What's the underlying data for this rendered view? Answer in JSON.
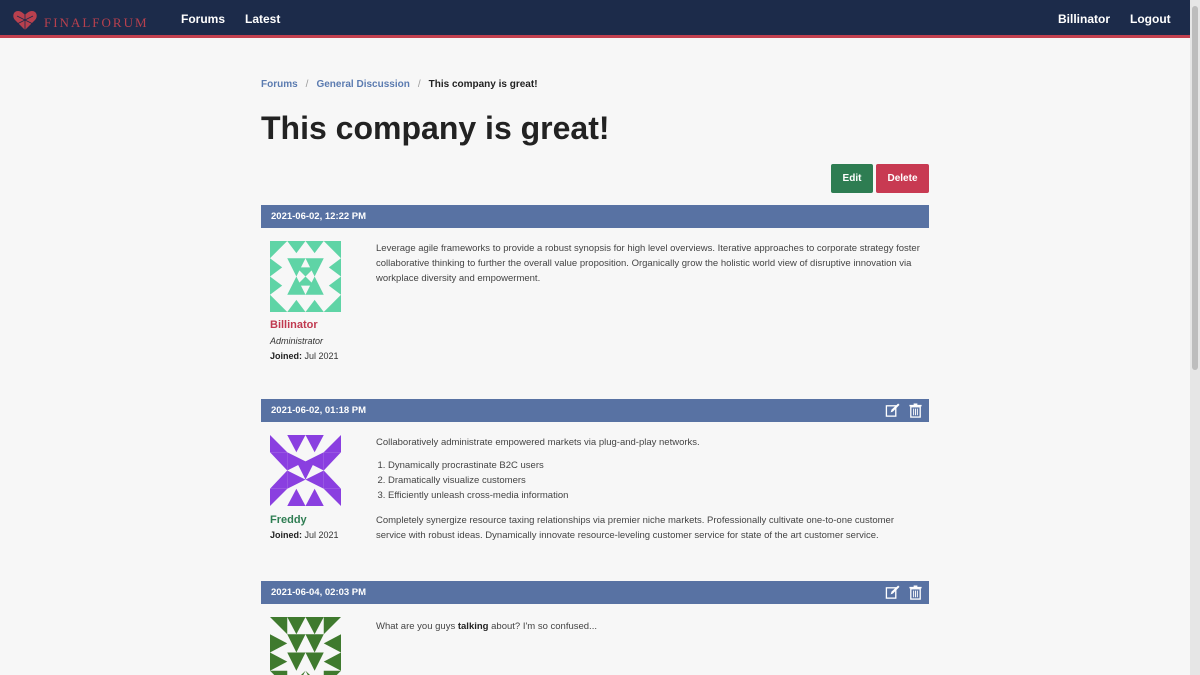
{
  "nav": {
    "brand": "FINALFORUM",
    "links": [
      "Forums",
      "Latest"
    ],
    "user": "Billinator",
    "logout": "Logout",
    "colors": {
      "bar": "#1c2b4a",
      "accent": "#c2404f"
    }
  },
  "breadcrumb": {
    "items": [
      "Forums",
      "General Discussion"
    ],
    "current": "This company is great!"
  },
  "title": "This company is great!",
  "actions": {
    "edit": "Edit",
    "delete": "Delete"
  },
  "posts": [
    {
      "timestamp": "2021-06-02, 12:22 PM",
      "show_actions": false,
      "author": {
        "name": "Billinator",
        "name_color": "#c0394f",
        "role": "Administrator",
        "joined_label": "Joined:",
        "joined": "Jul 2021",
        "avatar_color": "#5fd4a6"
      },
      "body": {
        "paragraphs": [
          "Leverage agile frameworks to provide a robust synopsis for high level overviews. Iterative approaches to corporate strategy foster collaborative thinking to further the overall value proposition. Organically grow the holistic world view of disruptive innovation via workplace diversity and empowerment."
        ]
      }
    },
    {
      "timestamp": "2021-06-02, 01:18 PM",
      "show_actions": true,
      "author": {
        "name": "Freddy",
        "name_color": "#2e7d52",
        "role": "",
        "joined_label": "Joined:",
        "joined": "Jul 2021",
        "avatar_color": "#8a3fe0"
      },
      "body": {
        "intro": "Collaboratively administrate empowered markets via plug-and-play networks.",
        "list": [
          "Dynamically procrastinate B2C users",
          "Dramatically visualize customers",
          "Efficiently unleash cross-media information"
        ],
        "outro": "Completely synergize resource taxing relationships via premier niche markets. Professionally cultivate one-to-one customer service with robust ideas. Dynamically innovate resource-leveling customer service for state of the art customer service."
      }
    },
    {
      "timestamp": "2021-06-04, 02:03 PM",
      "show_actions": true,
      "author": {
        "avatar_color": "#3f7a2e"
      },
      "body": {
        "before": "What are you guys ",
        "bold": "talking",
        "after": " about? I'm so confused..."
      }
    }
  ],
  "icons": [
    "heart-logo-icon",
    "edit-icon",
    "trash-icon"
  ]
}
